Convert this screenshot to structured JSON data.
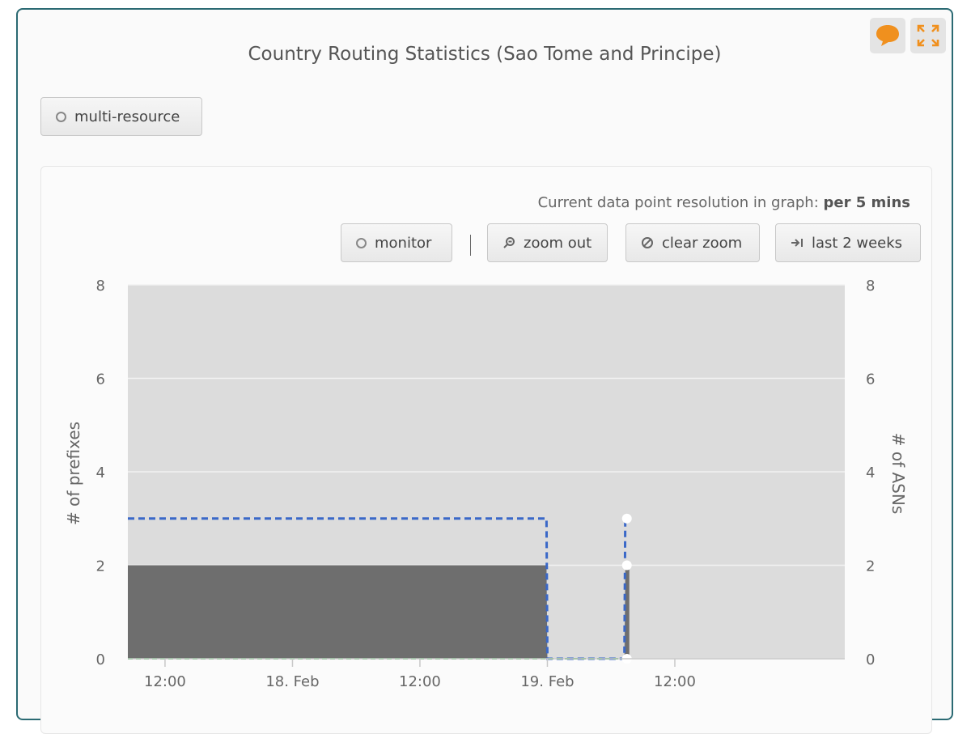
{
  "header": {
    "title": "Country Routing Statistics (Sao Tome and Principe)",
    "feedback_icon": "speech-bubble-icon",
    "fullscreen_icon": "expand-arrows-icon",
    "accent_color": "#f0901e"
  },
  "toolbar": {
    "multi_resource_label": "multi-resource",
    "resolution_prefix": "Current data point resolution in graph:",
    "resolution_value": "per 5 mins",
    "monitor_label": "monitor",
    "zoom_out_label": "zoom out",
    "clear_zoom_label": "clear zoom",
    "last_2_weeks_label": "last 2 weeks"
  },
  "chart_data": {
    "type": "area",
    "title": "",
    "ylabel_left": "# of prefixes",
    "ylabel_right": "# of ASNs",
    "ylim": [
      0,
      8
    ],
    "yticks": [
      0,
      2,
      4,
      6,
      8
    ],
    "xlim": [
      "2023-02-17T08:30",
      "2023-02-20T04:00"
    ],
    "xticks": [
      {
        "label": "12:00",
        "x": "2023-02-17T12:00"
      },
      {
        "label": "18. Feb",
        "x": "2023-02-18T00:00"
      },
      {
        "label": "12:00",
        "x": "2023-02-18T12:00"
      },
      {
        "label": "19. Feb",
        "x": "2023-02-19T00:00"
      },
      {
        "label": "12:00",
        "x": "2023-02-19T12:00"
      }
    ],
    "grid": true,
    "colors": {
      "plot_background": "#dcdcdc",
      "prefix_area": "#6e6e6e",
      "asn_line": "#3a68c8",
      "zero_line": "#3fae4e"
    },
    "series": [
      {
        "axis": "left",
        "style": "area",
        "points": [
          {
            "x": "2023-02-17T08:30",
            "y": 2
          },
          {
            "x": "2023-02-18T23:55",
            "y": 2
          },
          {
            "x": "2023-02-19T00:00",
            "y": 0
          },
          {
            "x": "2023-02-19T07:15",
            "y": 0
          },
          {
            "x": "2023-02-19T07:20",
            "y": 2
          }
        ]
      },
      {
        "axis": "right",
        "style": "dashed-line",
        "points": [
          {
            "x": "2023-02-17T08:30",
            "y": 3
          },
          {
            "x": "2023-02-18T23:55",
            "y": 3
          },
          {
            "x": "2023-02-19T00:00",
            "y": 0
          },
          {
            "x": "2023-02-19T07:15",
            "y": 0
          },
          {
            "x": "2023-02-19T07:20",
            "y": 3
          }
        ]
      },
      {
        "axis": "left",
        "style": "dashed-line-zero",
        "points": [
          {
            "x": "2023-02-17T08:30",
            "y": 0
          },
          {
            "x": "2023-02-19T07:20",
            "y": 0
          }
        ]
      }
    ],
    "markers": [
      {
        "x": "2023-02-19T07:20",
        "y": 3
      },
      {
        "x": "2023-02-19T07:20",
        "y": 2
      },
      {
        "x": "2023-02-19T07:20",
        "y": 0
      }
    ]
  }
}
